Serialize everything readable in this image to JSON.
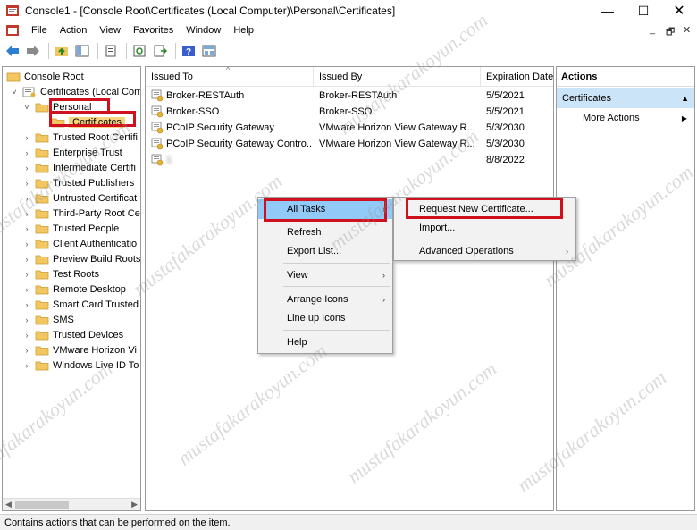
{
  "window": {
    "title": "Console1 - [Console Root\\Certificates (Local Computer)\\Personal\\Certificates]",
    "min": "—",
    "max": "☐",
    "close": "✕",
    "mdi_min": "_",
    "mdi_restore": "🗗",
    "mdi_close": "✕"
  },
  "menubar": [
    "File",
    "Action",
    "View",
    "Favorites",
    "Window",
    "Help"
  ],
  "tree": {
    "items": [
      {
        "label": "Console Root",
        "level": 0,
        "expanded": null
      },
      {
        "label": "Certificates (Local Com",
        "level": 1,
        "expanded": true
      },
      {
        "label": "Personal",
        "level": 2,
        "expanded": true
      },
      {
        "label": "Certificates",
        "level": 3,
        "expanded": null
      },
      {
        "label": "Trusted Root Certifi",
        "level": 2,
        "expanded": false
      },
      {
        "label": "Enterprise Trust",
        "level": 2,
        "expanded": false
      },
      {
        "label": "Intermediate Certifi",
        "level": 2,
        "expanded": false
      },
      {
        "label": "Trusted Publishers",
        "level": 2,
        "expanded": false
      },
      {
        "label": "Untrusted Certificat",
        "level": 2,
        "expanded": false
      },
      {
        "label": "Third-Party Root Ce",
        "level": 2,
        "expanded": false
      },
      {
        "label": "Trusted People",
        "level": 2,
        "expanded": false
      },
      {
        "label": "Client Authenticatio",
        "level": 2,
        "expanded": false
      },
      {
        "label": "Preview Build Roots",
        "level": 2,
        "expanded": false
      },
      {
        "label": "Test Roots",
        "level": 2,
        "expanded": false
      },
      {
        "label": "Remote Desktop",
        "level": 2,
        "expanded": false
      },
      {
        "label": "Smart Card Trusted",
        "level": 2,
        "expanded": false
      },
      {
        "label": "SMS",
        "level": 2,
        "expanded": false
      },
      {
        "label": "Trusted Devices",
        "level": 2,
        "expanded": false
      },
      {
        "label": "VMware Horizon Vi",
        "level": 2,
        "expanded": false
      },
      {
        "label": "Windows Live ID To",
        "level": 2,
        "expanded": false
      }
    ]
  },
  "list": {
    "columns": [
      "Issued To",
      "Issued By",
      "Expiration Date"
    ],
    "rows": [
      {
        "issued_to": "Broker-RESTAuth",
        "issued_by": "Broker-RESTAuth",
        "expiration": "5/5/2021",
        "blurred": false
      },
      {
        "issued_to": "Broker-SSO",
        "issued_by": "Broker-SSO",
        "expiration": "5/5/2021",
        "blurred": false
      },
      {
        "issued_to": "PCoIP Security Gateway",
        "issued_by": "VMware Horizon View Gateway R...",
        "expiration": "5/3/2030",
        "blurred": false
      },
      {
        "issued_to": "PCoIP Security Gateway Contro...",
        "issued_by": "VMware Horizon View Gateway R...",
        "expiration": "5/3/2030",
        "blurred": false
      },
      {
        "issued_to": "1",
        "issued_by": "",
        "expiration": "8/8/2022",
        "blurred": true
      }
    ]
  },
  "actions": {
    "header": "Actions",
    "section": "Certificates",
    "items": [
      "More Actions"
    ]
  },
  "context_menu": {
    "items": [
      "All Tasks",
      "Refresh",
      "Export List...",
      "View",
      "Arrange Icons",
      "Line up Icons",
      "Help"
    ]
  },
  "submenu": {
    "items": [
      "Request New Certificate...",
      "Import...",
      "Advanced Operations"
    ]
  },
  "statusbar": "Contains actions that can be performed on the item.",
  "watermark": "mustafakarakoyun.com",
  "colors": {
    "highlight": "#91c9f7",
    "actions_section": "#cce4f7",
    "annotation_red": "#d0101c",
    "folder": "#f2c660"
  }
}
